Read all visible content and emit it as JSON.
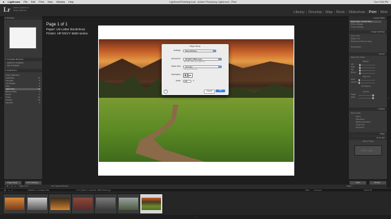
{
  "menubar": {
    "apple": "",
    "items": [
      "Lightroom",
      "File",
      "Edit",
      "Print",
      "View",
      "Window",
      "Help"
    ],
    "window_title": "LightroomFinishing.lrcat - Adobe Photoshop Lightroom - Print",
    "clock": "Sun 3:56 PM"
  },
  "identity": {
    "logo": "Lr",
    "app_line1": "Adobe Lightroom",
    "app_line2": "Serge Ramelli"
  },
  "modules": [
    "Library",
    "Develop",
    "Map",
    "Book",
    "Slideshow",
    "Print",
    "Web"
  ],
  "active_module": "Print",
  "left_panel": {
    "preview_header": "Preview",
    "template_browser_header": "Template Browser",
    "templates": [
      "Lightroom Templates",
      "User Templates"
    ],
    "collections_header": "Collections",
    "collections": [
      {
        "label": "Smart Collections",
        "count": ""
      },
      {
        "label": "Landscape",
        "count": "12"
      },
      {
        "label": "Cityscape",
        "count": "8"
      },
      {
        "label": "Los Angeles",
        "count": "6"
      },
      {
        "label": "Paris",
        "count": "9"
      },
      {
        "label": "Night shots",
        "count": "11"
      },
      {
        "label": "Black & White",
        "count": "7"
      },
      {
        "label": "Sunset",
        "count": "5"
      },
      {
        "label": "Travel",
        "count": "14"
      },
      {
        "label": "Portfolio",
        "count": "20"
      },
      {
        "label": "Favorites",
        "count": "4"
      }
    ],
    "page_setup_btn": "Page Setup...",
    "print_settings_btn": "Print Settings..."
  },
  "center": {
    "page_count": "Page 1 of 1",
    "paper": "Paper: US Letter Borderless",
    "printer": "Printer: HP ENVY 5660 series"
  },
  "dialog": {
    "title": "Page Setup",
    "settings_label": "Settings:",
    "settings_value": "Page Attributes",
    "format_label": "Format For:",
    "format_value": "HP ENVY 5660 series",
    "format_sub": "HP ENVY 5660 series (AirPrint)",
    "paper_label": "Paper Size:",
    "paper_value": "US Letter",
    "paper_sub": "8.50 by 11.00 inches",
    "orientation_label": "Orientation:",
    "scale_label": "Scale:",
    "scale_value": "100",
    "scale_unit": "%",
    "help": "?",
    "cancel": "Cancel",
    "ok": "OK"
  },
  "right_panel": {
    "layout_style_header": "Layout Style",
    "layout_styles": [
      "Single Image / Contact Sheet",
      "Picture Package",
      "Custom Package"
    ],
    "image_settings_header": "Image Settings",
    "image_settings": [
      "Zoom to Fill",
      "Rotate to Fit",
      "Repeat One Photo per Page",
      "Stroke Border"
    ],
    "layout_header": "Layout",
    "ruler_units": "Ruler Units: Inches",
    "margins_label": "Margins",
    "margins": [
      "Left",
      "Right",
      "Top",
      "Bottom"
    ],
    "page_grid_label": "Page Grid",
    "grid": [
      "Rows",
      "Columns"
    ],
    "cell_spacing_label": "Cell Spacing",
    "cell_size_label": "Cell Size",
    "cell_size": [
      "Height",
      "Width"
    ],
    "guides_header": "Guides",
    "guides": [
      "Show Guides",
      "Rulers",
      "Page Bleed",
      "Margins and Gutters",
      "Image Cells",
      "Dimensions"
    ],
    "page_header": "Page",
    "print_job_header": "Print Job",
    "print_to": "Print to: Printer",
    "print_button": "Print Job...",
    "print_btn": "Print",
    "printer_btn": "Printer..."
  },
  "toolbar": {
    "page_info": "Page 1 of 1",
    "use": "Use: Selected Photos",
    "page_label": "Page 1"
  },
  "filmbar": {
    "source": "Collection : LA Classy Jobs",
    "selected": "7 of 7 photos / 1 selected / 4ZN4 Scenic.jpg",
    "filter_label": "Filter :",
    "filter_value": "Filters Off"
  },
  "filmstrip_colors": [
    "#b05a24",
    "#9a9a9a",
    "#c0702c",
    "#7a3a2a",
    "#5a5a5a",
    "#6a7a5a",
    "#6b8a32"
  ]
}
